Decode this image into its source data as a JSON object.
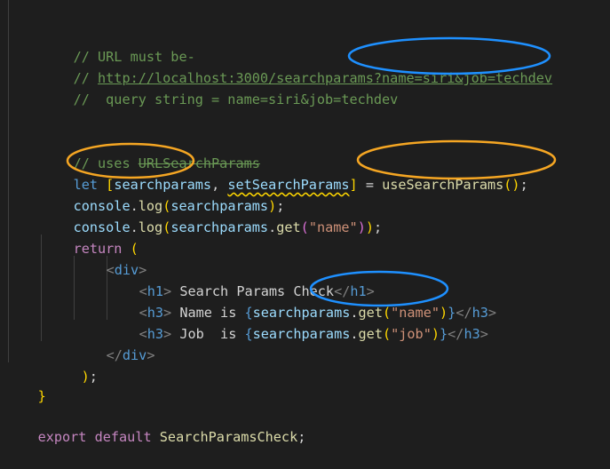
{
  "code": {
    "comment_url_must_be": "// URL must be-",
    "comment_url_prefix": "// ",
    "url_text": "http://localhost:3000/searchparams?name=siri&job=techdev",
    "comment_query": "//  query string = name=siri&job=techdev",
    "comment_uses": "// uses ",
    "comment_uses_strike": "URLSearchParams",
    "kw_let": "let",
    "var_searchparams": "searchparams",
    "var_setSearchParams": "setSearchParams",
    "fn_useSearchParams": "useSearchParams",
    "var_console": "console",
    "fn_log": "log",
    "fn_get": "get",
    "str_name": "\"name\"",
    "str_job": "\"job\"",
    "kw_return": "return",
    "tag_div": "div",
    "tag_h1": "h1",
    "tag_h3": "h3",
    "text_h1": " Search Params Check",
    "text_name_is": " Name is ",
    "text_job_is": " Job  is ",
    "kw_export": "export",
    "kw_default": "default",
    "fn_component": "SearchParamsCheck"
  },
  "annotations": [
    {
      "name": "blue-ellipse-query-string",
      "color": "#1e90ff"
    },
    {
      "name": "gold-ellipse-searchparams",
      "color": "#f5a623"
    },
    {
      "name": "gold-ellipse-usesearchparams",
      "color": "#f5a623"
    },
    {
      "name": "blue-ellipse-get-name",
      "color": "#1e90ff"
    }
  ],
  "colors": {
    "background": "#1e1e1e",
    "comment": "#6a9955",
    "keyword": "#569cd6",
    "control": "#c586c0",
    "variable": "#9cdcfe",
    "function": "#dcdcaa",
    "string": "#ce9178",
    "annotation_blue": "#1e90ff",
    "annotation_gold": "#f5a623"
  }
}
